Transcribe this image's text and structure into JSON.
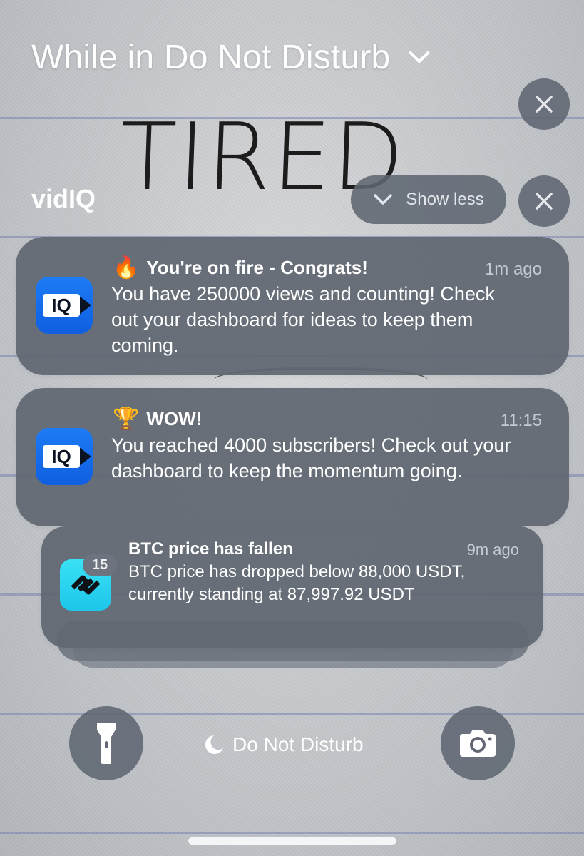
{
  "header": {
    "title": "While in Do Not Disturb"
  },
  "group": {
    "app_name": "vidIQ",
    "show_less_label": "Show less"
  },
  "notifications": [
    {
      "emoji": "🔥",
      "title": "You're on fire - Congrats!",
      "time": "1m ago",
      "body": "You have 250000 views and counting! Check out your dashboard for ideas to keep them coming.",
      "icon": "vidiq-app-icon",
      "icon_text": "IQ"
    },
    {
      "emoji": "🏆",
      "title": "WOW!",
      "time": "11:15",
      "body": "You reached 4000 subscribers!  Check out your dashboard to keep the momentum going.",
      "icon": "vidiq-app-icon",
      "icon_text": "IQ"
    }
  ],
  "stacked_notification": {
    "title": "BTC price has fallen",
    "time": "9m ago",
    "body": "BTC price has dropped below 88,000 USDT, currently standing at 87,997.92 USDT",
    "badge": "15",
    "icon": "exchange-app-icon"
  },
  "bottom": {
    "dnd_label": "Do Not Disturb"
  },
  "colors": {
    "card": "#616872",
    "vidiq_blue": "#1d7bf6",
    "exchange_cyan": "#29d3f0"
  }
}
